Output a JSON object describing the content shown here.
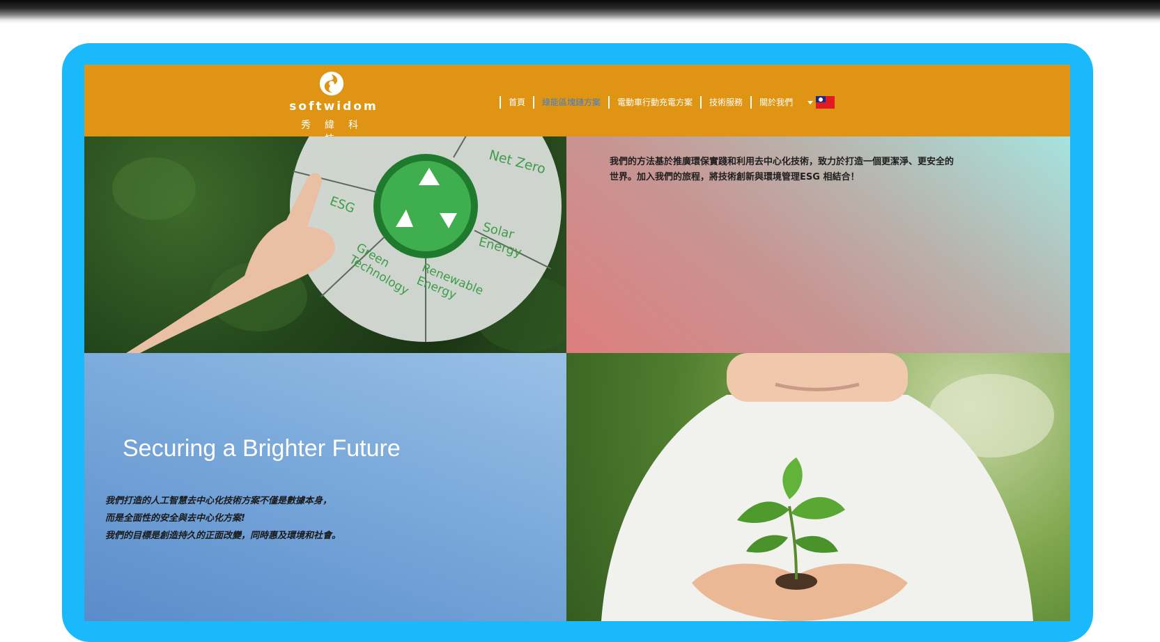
{
  "brand": {
    "name": "softwidom",
    "name_cn": "秀緯科技"
  },
  "nav": [
    {
      "label": "首頁"
    },
    {
      "label": "綠能區塊鏈方案"
    },
    {
      "label": "電動車行動充電方案"
    },
    {
      "label": "技術服務"
    },
    {
      "label": "關於我們"
    }
  ],
  "language": {
    "flag": "taiwan-flag"
  },
  "wheel": {
    "segments": [
      "Net Zero",
      "ESG",
      "Solar Energy",
      "Green Technology",
      "Renewable Energy"
    ]
  },
  "intro": {
    "line1": "我們的方法基於推廣環保實踐和利用去中心化技術，致力於打造一個更潔淨、更安全的",
    "line2": "世界。加入我們的旅程，將技術創新與環境管理ESG 相結合！"
  },
  "hero": {
    "title": "Securing a Brighter Future",
    "lines": [
      "我們打造的人工智慧去中心化技術方案不僅是數據本身，",
      "而是全面性的安全與去中心化方案!",
      "我們的目標是創造持久的正面改變，同時惠及環境和社會。"
    ]
  },
  "colors": {
    "frame": "#1ab9fb",
    "header": "#df9413",
    "nav_active": "#3b7fd6"
  }
}
